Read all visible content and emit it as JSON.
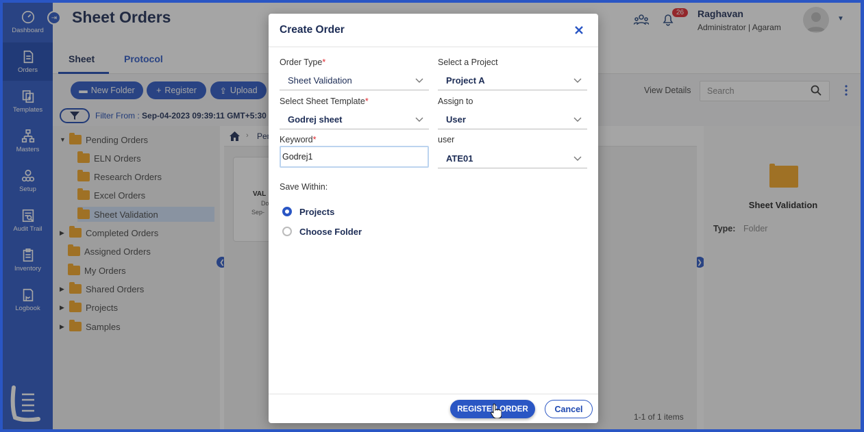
{
  "app": {
    "page_title": "Sheet Orders",
    "notification_count": "26",
    "user": {
      "name": "Raghavan",
      "role": "Administrator | Agaram"
    }
  },
  "sidebar": {
    "items": [
      {
        "label": "Dashboard",
        "icon": "dashboard-icon"
      },
      {
        "label": "Orders",
        "icon": "orders-icon",
        "active": true
      },
      {
        "label": "Templates",
        "icon": "templates-icon"
      },
      {
        "label": "Masters",
        "icon": "masters-icon"
      },
      {
        "label": "Setup",
        "icon": "setup-icon"
      },
      {
        "label": "Audit Trail",
        "icon": "audit-trail-icon"
      },
      {
        "label": "Inventory",
        "icon": "inventory-icon"
      },
      {
        "label": "Logbook",
        "icon": "logbook-icon"
      }
    ]
  },
  "tabs": [
    {
      "label": "Sheet",
      "active": true
    },
    {
      "label": "Protocol",
      "active": false
    }
  ],
  "toolbar": {
    "new_folder": "New Folder",
    "register": "Register",
    "upload": "Upload",
    "view_details": "View Details",
    "search_placeholder": "Search"
  },
  "filter": {
    "label": "Filter From :",
    "value": "Sep-04-2023 09:39:11 GMT+5:30"
  },
  "tree": {
    "pending": "Pending Orders",
    "eln": "ELN Orders",
    "research": "Research Orders",
    "excel": "Excel Orders",
    "sheet_validation": "Sheet Validation",
    "completed": "Completed Orders",
    "assigned": "Assigned Orders",
    "my_orders": "My Orders",
    "shared": "Shared Orders",
    "projects": "Projects",
    "samples": "Samples"
  },
  "center": {
    "breadcrumb_partial": "Pen",
    "card_title_partial": "VAL",
    "card_line2_partial": "Do",
    "card_line3_partial": "Sep-",
    "pager": "1-1 of 1 items"
  },
  "details": {
    "name": "Sheet Validation",
    "type_label": "Type:",
    "type_value": "Folder"
  },
  "modal": {
    "title": "Create Order",
    "order_type": {
      "label": "Order Type",
      "value": "Sheet Validation"
    },
    "project": {
      "label": "Select a Project",
      "value": "Project A"
    },
    "template": {
      "label": "Select Sheet Template",
      "value": "Godrej sheet"
    },
    "assign_to": {
      "label": "Assign to",
      "value": "User"
    },
    "keyword": {
      "label": "Keyword",
      "value": "Godrej1"
    },
    "user": {
      "label": "user",
      "value": "ATE01"
    },
    "save_within": "Save Within:",
    "radio_projects": "Projects",
    "radio_folder": "Choose Folder",
    "register_btn": "REGISTER ORDER",
    "cancel_btn": "Cancel"
  },
  "colors": {
    "primary": "#2a56c4",
    "sidebar_active": "#1c47b0",
    "required": "#e0262d",
    "folder": "#f5a623"
  }
}
